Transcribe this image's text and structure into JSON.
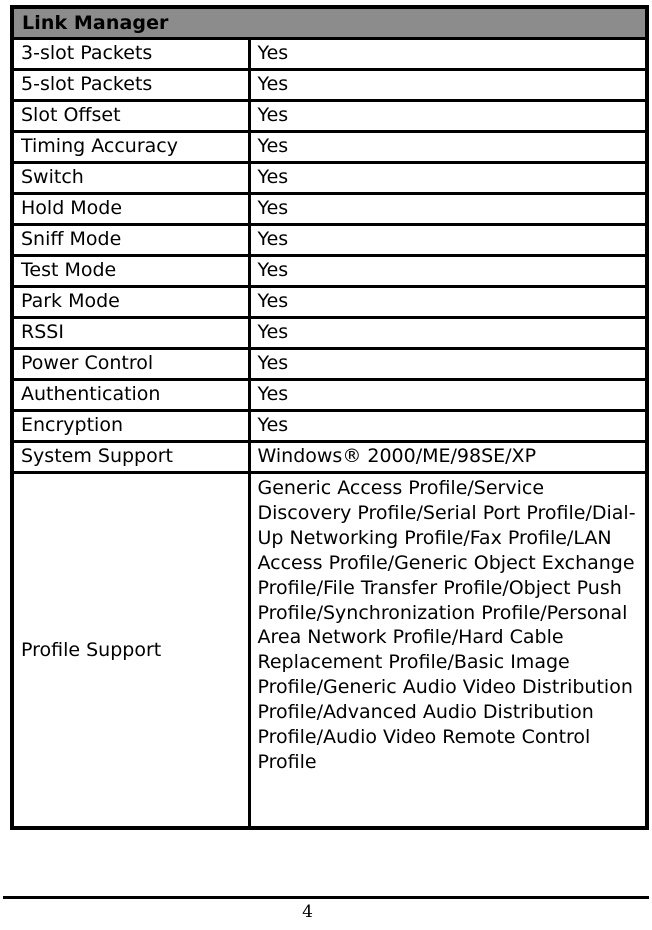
{
  "table": {
    "section_header": "Link Manager",
    "rows": [
      {
        "label": "3-slot Packets",
        "value": "Yes"
      },
      {
        "label": "5-slot Packets",
        "value": "Yes"
      },
      {
        "label": "Slot Offset",
        "value": "Yes"
      },
      {
        "label": "Timing Accuracy",
        "value": "Yes"
      },
      {
        "label": "Switch",
        "value": "Yes"
      },
      {
        "label": "Hold Mode",
        "value": "Yes"
      },
      {
        "label": "Sniff Mode",
        "value": "Yes"
      },
      {
        "label": "Test Mode",
        "value": "Yes"
      },
      {
        "label": "Park Mode",
        "value": "Yes"
      },
      {
        "label": "RSSI",
        "value": "Yes"
      },
      {
        "label": "Power Control",
        "value": "Yes"
      },
      {
        "label": "Authentication",
        "value": "Yes"
      },
      {
        "label": "Encryption",
        "value": "Yes"
      },
      {
        "label": "System Support",
        "value": "Windows® 2000/ME/98SE/XP"
      }
    ],
    "profile_support": {
      "label": "Profile Support",
      "value": "Generic Access Profile/Service Discovery Profile/Serial Port Profile/Dial-Up Networking Profile/Fax Profile/LAN Access Profile/Generic Object Exchange Profile/File Transfer Profile/Object Push Profile/Synchronization Profile/Personal Area Network Profile/Hard Cable Replacement Profile/Basic Image Profile/Generic Audio Video Distribution Profile/Advanced Audio Distribution Profile/Audio Video Remote Control Profile"
    }
  },
  "footer": {
    "page_number": "4"
  },
  "colors": {
    "section_header_background": "#8c8c8c",
    "border": "#000000",
    "text": "#000000",
    "page_background": "#ffffff"
  }
}
